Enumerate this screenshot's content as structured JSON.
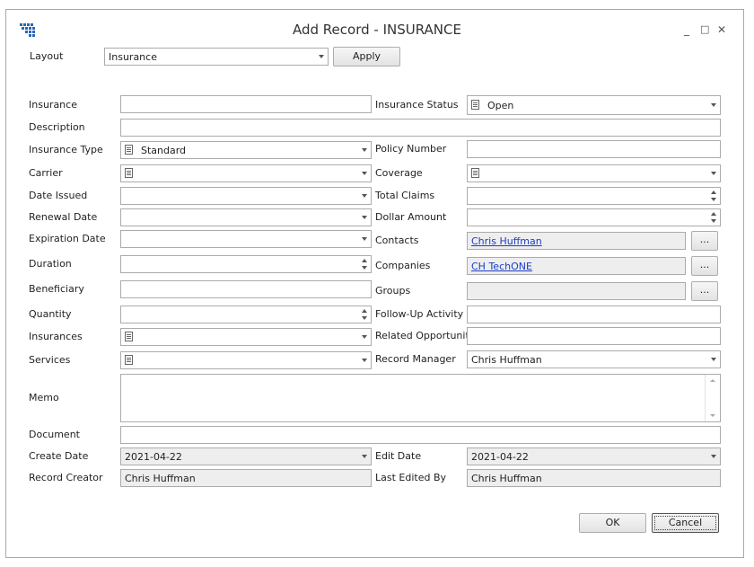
{
  "window": {
    "title": "Add Record - INSURANCE",
    "minimize_glyph": "_",
    "maximize_glyph": "□",
    "close_glyph": "✕",
    "app_icon": "grid-app-icon"
  },
  "layout": {
    "label": "Layout",
    "value": "Insurance",
    "apply_label": "Apply"
  },
  "fields": {
    "insurance": {
      "label": "Insurance",
      "value": ""
    },
    "insurance_status": {
      "label": "Insurance Status",
      "value": "Open"
    },
    "description": {
      "label": "Description",
      "value": ""
    },
    "insurance_type": {
      "label": "Insurance Type",
      "value": "Standard"
    },
    "policy_number": {
      "label": "Policy Number",
      "value": ""
    },
    "carrier": {
      "label": "Carrier",
      "value": ""
    },
    "coverage": {
      "label": "Coverage",
      "value": ""
    },
    "date_issued": {
      "label": "Date Issued",
      "value": ""
    },
    "total_claims": {
      "label": "Total Claims",
      "value": ""
    },
    "renewal_date": {
      "label": "Renewal Date",
      "value": ""
    },
    "dollar_amount": {
      "label": "Dollar Amount",
      "value": ""
    },
    "expiration_date": {
      "label": "Expiration Date",
      "value": ""
    },
    "contacts": {
      "label": "Contacts",
      "value": "Chris Huffman",
      "button": "..."
    },
    "duration": {
      "label": "Duration",
      "value": ""
    },
    "companies": {
      "label": "Companies",
      "value": "CH TechONE",
      "button": "..."
    },
    "beneficiary": {
      "label": "Beneficiary",
      "value": ""
    },
    "groups": {
      "label": "Groups",
      "value": "",
      "button": "..."
    },
    "quantity": {
      "label": "Quantity",
      "value": ""
    },
    "follow_up": {
      "label": "Follow-Up Activity",
      "value": ""
    },
    "insurances": {
      "label": "Insurances",
      "value": ""
    },
    "related_opportunity": {
      "label": "Related Opportunity",
      "value": ""
    },
    "services": {
      "label": "Services",
      "value": ""
    },
    "record_manager": {
      "label": "Record Manager",
      "value": "Chris Huffman"
    },
    "memo": {
      "label": "Memo",
      "value": ""
    },
    "document": {
      "label": "Document",
      "value": ""
    },
    "create_date": {
      "label": "Create Date",
      "value": "2021-04-22"
    },
    "edit_date": {
      "label": "Edit Date",
      "value": "2021-04-22"
    },
    "record_creator": {
      "label": "Record Creator",
      "value": "Chris Huffman"
    },
    "last_edited_by": {
      "label": "Last Edited By",
      "value": "Chris Huffman"
    }
  },
  "footer": {
    "ok_label": "OK",
    "cancel_label": "Cancel"
  }
}
